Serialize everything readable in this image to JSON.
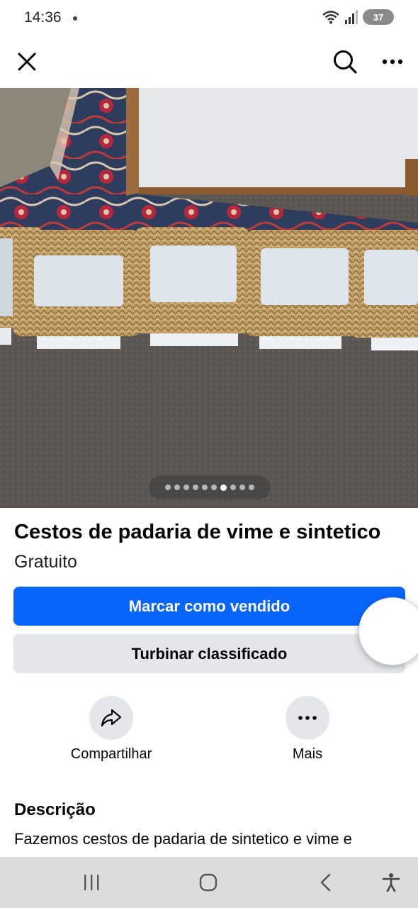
{
  "status_bar": {
    "time": "14:36",
    "battery": "37"
  },
  "top_bar": {
    "close_icon": "close-icon",
    "search_icon": "search-icon",
    "more_icon": "more-horizontal-icon"
  },
  "gallery": {
    "total_images": 10,
    "current_index": 7
  },
  "listing": {
    "title": "Cestos de padaria de vime e sintetico",
    "price": "Gratuito"
  },
  "buttons": {
    "mark_sold": "Marcar como vendido",
    "boost": "Turbinar classificado"
  },
  "actions": {
    "share_label": "Compartilhar",
    "more_label": "Mais"
  },
  "description": {
    "heading": "Descrição",
    "text": "Fazemos cestos de padaria de sintetico e vime e"
  },
  "colors": {
    "primary": "#0866ff",
    "secondary_bg": "#e4e6eb",
    "nav_bg": "#dcdcdc"
  }
}
